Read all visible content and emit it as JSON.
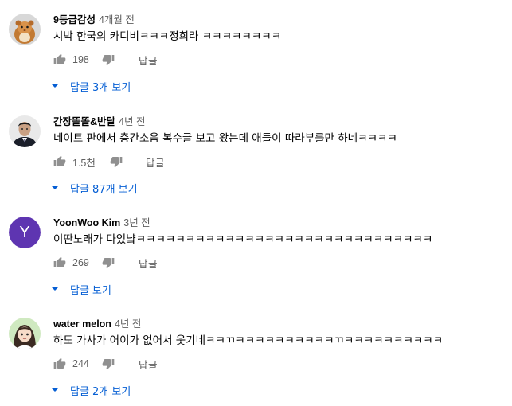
{
  "comments": [
    {
      "author": "9등급감성",
      "time": "4개월 전",
      "text": "시박 한국의 카디비ㅋㅋㅋ정희라 ㅋㅋㅋㅋㅋㅋㅋㅋ",
      "likes": "198",
      "reply_label": "답글",
      "replies_label": "답글 3개 보기",
      "avatar": "hamster-photo"
    },
    {
      "author": "간장똘똘&반달",
      "time": "4년 전",
      "text": "네이트 판에서  층간소음 복수글 보고 왔는데  애들이 따라부를만 하네ㅋㅋㅋㅋ",
      "likes": "1.5천",
      "reply_label": "답글",
      "replies_label": "답글 87개 보기",
      "avatar": "man-photo"
    },
    {
      "author": "YoonWoo Kim",
      "time": "3년 전",
      "text": "이딴노래가 다있냨ㅋㅋㅋㅋㅋㅋㅋㅋㅋㅋㅋㅋㅋㅋㅋㅋㅋㅋㅋㅋㅋㅋㅋㅋㅋㅋㅋㅋㅋㅋ",
      "likes": "269",
      "reply_label": "답글",
      "replies_label": "답글 보기",
      "avatar_letter": "Y",
      "avatar_color": "#5e35b1"
    },
    {
      "author": "water melon",
      "time": "4년 전",
      "text": "하도 가사가 어이가 없어서 웃기네ㅋㅋㄲㅋㅋㅋㅋㅋㅋㅋㅋㅋㅋㄲㅋㅋㅋㅋㅋㅋㅋㅋㅋㅋ",
      "likes": "244",
      "reply_label": "답글",
      "replies_label": "답글 2개 보기",
      "avatar": "anime-girl-drawing"
    }
  ],
  "icons": {
    "like": "thumb-up-icon",
    "dislike": "thumb-down-icon",
    "expand": "caret-down-icon"
  },
  "colors": {
    "link": "#065fd4",
    "secondary_text": "#606060",
    "icon": "#909090"
  }
}
